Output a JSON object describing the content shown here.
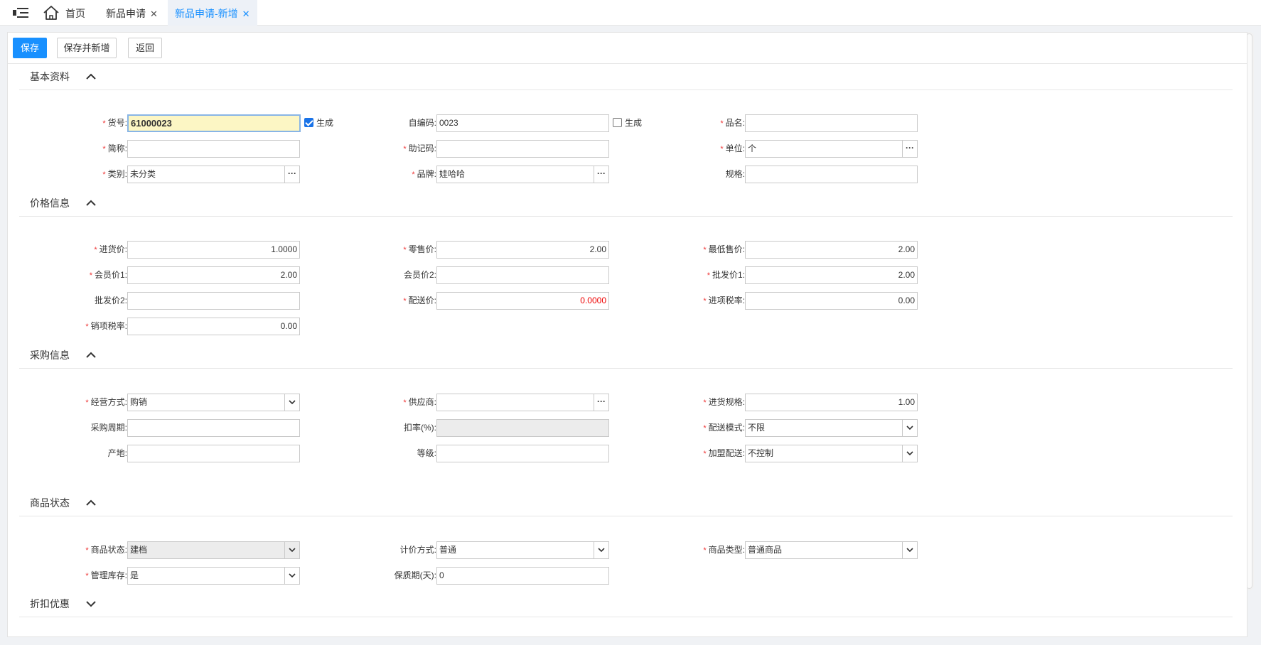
{
  "tabs": {
    "home": "首页",
    "list": "新品申请",
    "active": "新品申请-新增",
    "close": "✕"
  },
  "toolbar": {
    "save": "保存",
    "save_new": "保存并新增",
    "back": "返回"
  },
  "sections": {
    "basic": "基本资料",
    "price": "价格信息",
    "purchase": "采购信息",
    "status": "商品状态",
    "discount": "折扣优惠"
  },
  "basic": {
    "item_no_label": "货号:",
    "item_no": "61000023",
    "item_no_gen": "生成",
    "self_code_label": "自编码:",
    "self_code": "0023",
    "self_code_gen": "生成",
    "name_label": "品名:",
    "name": "",
    "short_label": "简称:",
    "short": "",
    "mnemonic_label": "助记码:",
    "mnemonic": "",
    "unit_label": "单位:",
    "unit": "个",
    "category_label": "类别:",
    "category": "未分类",
    "brand_label": "品牌:",
    "brand": "娃哈哈",
    "spec_label": "规格:",
    "spec": ""
  },
  "price": {
    "purchase_label": "进货价:",
    "purchase": "1.0000",
    "retail_label": "零售价:",
    "retail": "2.00",
    "min_sale_label": "最低售价:",
    "min_sale": "2.00",
    "member1_label": "会员价1:",
    "member1": "2.00",
    "member2_label": "会员价2:",
    "member2": "",
    "wholesale1_label": "批发价1:",
    "wholesale1": "2.00",
    "wholesale2_label": "批发价2:",
    "wholesale2": "",
    "delivery_label": "配送价:",
    "delivery": "0.0000",
    "input_tax_label": "进项税率:",
    "input_tax": "0.00",
    "output_tax_label": "销项税率:",
    "output_tax": "0.00"
  },
  "purchase": {
    "mode_label": "经营方式:",
    "mode": "购销",
    "supplier_label": "供应商:",
    "supplier": "",
    "pack_label": "进货规格:",
    "pack": "1.00",
    "cycle_label": "采购周期:",
    "cycle": "",
    "rate_label": "扣率(%):",
    "rate": "",
    "delivery_mode_label": "配送模式:",
    "delivery_mode": "不限",
    "origin_label": "产地:",
    "origin": "",
    "grade_label": "等级:",
    "grade": "",
    "franchise_label": "加盟配送:",
    "franchise": "不控制"
  },
  "status": {
    "state_label": "商品状态:",
    "state": "建档",
    "pricing_label": "计价方式:",
    "pricing": "普通",
    "type_label": "商品类型:",
    "type": "普通商品",
    "stock_label": "管理库存:",
    "stock": "是",
    "shelf_label": "保质期(天):",
    "shelf": "0"
  },
  "colors": {
    "accent": "#1890ff",
    "required": "#ee3333",
    "focus_bg": "#fcf6c4"
  }
}
